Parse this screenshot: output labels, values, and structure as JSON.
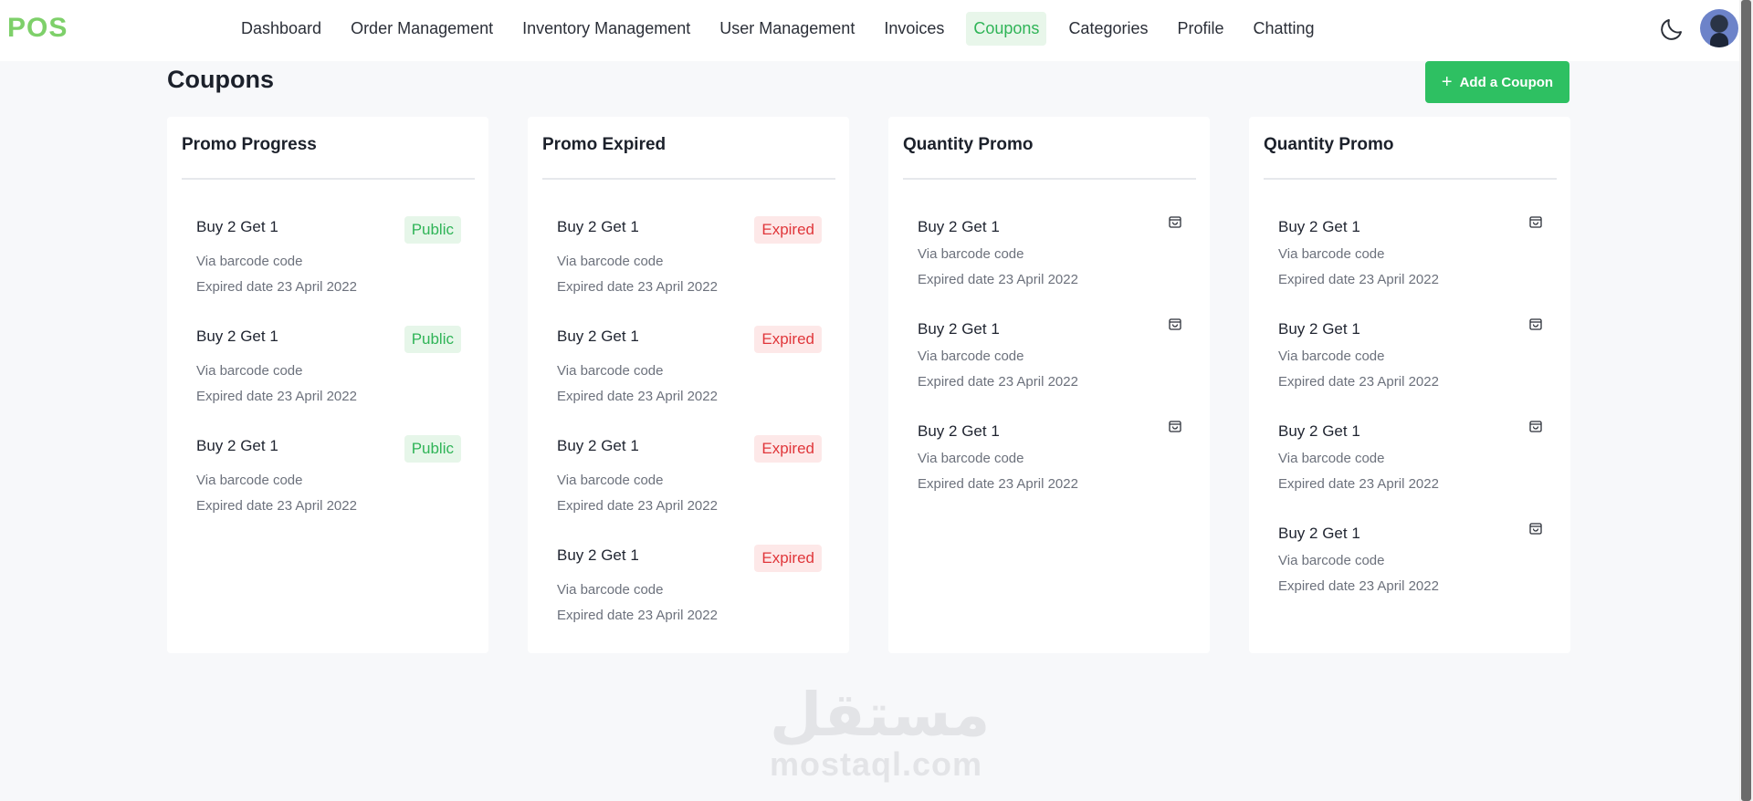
{
  "app": {
    "logo": "POS"
  },
  "nav": {
    "items": [
      {
        "label": "Dashboard"
      },
      {
        "label": "Order Management"
      },
      {
        "label": "Inventory Management"
      },
      {
        "label": "User Management"
      },
      {
        "label": "Invoices"
      },
      {
        "label": "Coupons",
        "active": true
      },
      {
        "label": "Categories"
      },
      {
        "label": "Profile"
      },
      {
        "label": "Chatting"
      }
    ]
  },
  "header_icons": {
    "theme_toggle": "moon-icon",
    "avatar": "user-avatar"
  },
  "page": {
    "title": "Coupons",
    "add_button_label": "Add a Coupon"
  },
  "cards": [
    {
      "title": "Promo Progress",
      "items": [
        {
          "name": "Buy 2 Get 1",
          "method": "Via barcode code",
          "expiry": "Expired date 23 April 2022",
          "badge": "Public"
        },
        {
          "name": "Buy 2 Get 1",
          "method": "Via barcode code",
          "expiry": "Expired date 23 April 2022",
          "badge": "Public"
        },
        {
          "name": "Buy 2 Get 1",
          "method": "Via barcode code",
          "expiry": "Expired date 23 April 2022",
          "badge": "Public"
        }
      ]
    },
    {
      "title": "Promo Expired",
      "items": [
        {
          "name": "Buy 2 Get 1",
          "method": "Via barcode code",
          "expiry": "Expired date 23 April 2022",
          "badge": "Expired"
        },
        {
          "name": "Buy 2 Get 1",
          "method": "Via barcode code",
          "expiry": "Expired date 23 April 2022",
          "badge": "Expired"
        },
        {
          "name": "Buy 2 Get 1",
          "method": "Via barcode code",
          "expiry": "Expired date 23 April 2022",
          "badge": "Expired"
        },
        {
          "name": "Buy 2 Get 1",
          "method": "Via barcode code",
          "expiry": "Expired date 23 April 2022",
          "badge": "Expired"
        }
      ]
    },
    {
      "title": "Quantity Promo",
      "items": [
        {
          "name": "Buy 2 Get 1",
          "method": "Via barcode code",
          "expiry": "Expired date 23 April 2022",
          "icon": "shopping-bag-icon"
        },
        {
          "name": "Buy 2 Get 1",
          "method": "Via barcode code",
          "expiry": "Expired date 23 April 2022",
          "icon": "shopping-bag-icon"
        },
        {
          "name": "Buy 2 Get 1",
          "method": "Via barcode code",
          "expiry": "Expired date 23 April 2022",
          "icon": "shopping-bag-icon"
        }
      ]
    },
    {
      "title": "Quantity Promo",
      "items": [
        {
          "name": "Buy 2 Get 1",
          "method": "Via barcode code",
          "expiry": "Expired date 23 April 2022",
          "icon": "shopping-bag-icon"
        },
        {
          "name": "Buy 2 Get 1",
          "method": "Via barcode code",
          "expiry": "Expired date 23 April 2022",
          "icon": "shopping-bag-icon"
        },
        {
          "name": "Buy 2 Get 1",
          "method": "Via barcode code",
          "expiry": "Expired date 23 April 2022",
          "icon": "shopping-bag-icon"
        },
        {
          "name": "Buy 2 Get 1",
          "method": "Via barcode code",
          "expiry": "Expired date 23 April 2022",
          "icon": "shopping-bag-icon"
        }
      ]
    }
  ],
  "watermark": {
    "arabic": "مستقل",
    "latin": "mostaql.com"
  },
  "colors": {
    "accent": "#2ec062",
    "logo": "#7ed06a",
    "public": "#2fb457",
    "expired": "#e0373b",
    "background": "#f7f8fa"
  }
}
